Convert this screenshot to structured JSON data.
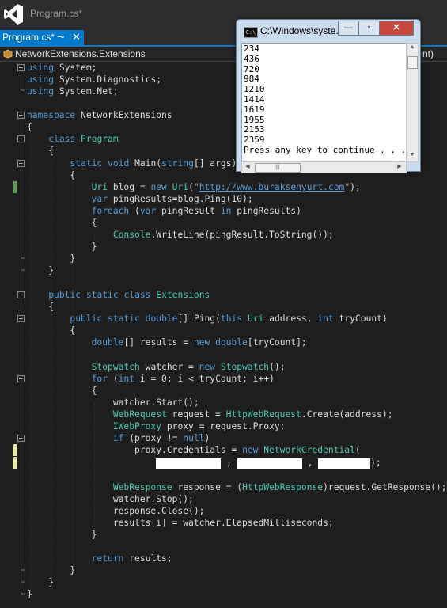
{
  "window": {
    "title": "Program.cs*"
  },
  "tab": {
    "label": "Program.cs*",
    "pin": "⊸",
    "close": "✕"
  },
  "navbar": {
    "scope": "NetworkExtensions.Extensions",
    "right_fragment": "nt)"
  },
  "colors": {
    "accent": "#007acc",
    "editor_bg": "#1e1e1e",
    "keyword": "#569cd6",
    "type": "#4ec9b0",
    "string": "#d69d85",
    "change_saved": "#57a64a",
    "change_unsaved": "#efef91"
  },
  "code": {
    "l1": "using System;",
    "l2": "using System.Diagnostics;",
    "l3": "using System.Net;",
    "l5": "namespace NetworkExtensions",
    "l6": "{",
    "l7": "class Program",
    "l8": "{",
    "l9": "static void Main(string[] args)",
    "l10": "{",
    "l11_url": "http://www.buraksenyurt.com",
    "l12": "var pingResults=blog.Ping(10);",
    "l13": "foreach (var pingResult in pingResults)",
    "l14": "{",
    "l15": "Console.WriteLine(pingResult.ToString());",
    "l16": "}",
    "l17": "}",
    "l18": "}",
    "l20": "public static class Extensions",
    "l21": "{",
    "l22": "public static double[] Ping(this Uri address, int tryCount)",
    "l23": "{",
    "l24": "double[] results = new double[tryCount];",
    "l26": "Stopwatch watcher = new Stopwatch();",
    "l27": "for (int i = 0; i < tryCount; i++)",
    "l28": "{",
    "l29": "watcher.Start();",
    "l30": "WebRequest request = HttpWebRequest.Create(address);",
    "l31": "IWebProxy proxy = request.Proxy;",
    "l32": "if (proxy != null)",
    "l33": "proxy.Credentials = new NetworkCredential(",
    "l34_sep": ",",
    "l34_end": ");",
    "l36": "WebResponse response = (HttpWebResponse)request.GetResponse();",
    "l37": "watcher.Stop();",
    "l38": "response.Close();",
    "l39": "results[i] = watcher.ElapsedMilliseconds;",
    "l40": "}",
    "l42": "return results;",
    "l43": "}",
    "l44": "}",
    "l45": "}"
  },
  "console": {
    "title": "C:\\Windows\\syste...",
    "icon_text": "C:\\",
    "minimize": "—",
    "maximize": "▫",
    "close": "✕",
    "lines": [
      "234",
      "436",
      "720",
      "984",
      "1210",
      "1414",
      "1619",
      "1955",
      "2153",
      "2359",
      "Press any key to continue . . ."
    ],
    "hscroll_grip": "|||"
  }
}
